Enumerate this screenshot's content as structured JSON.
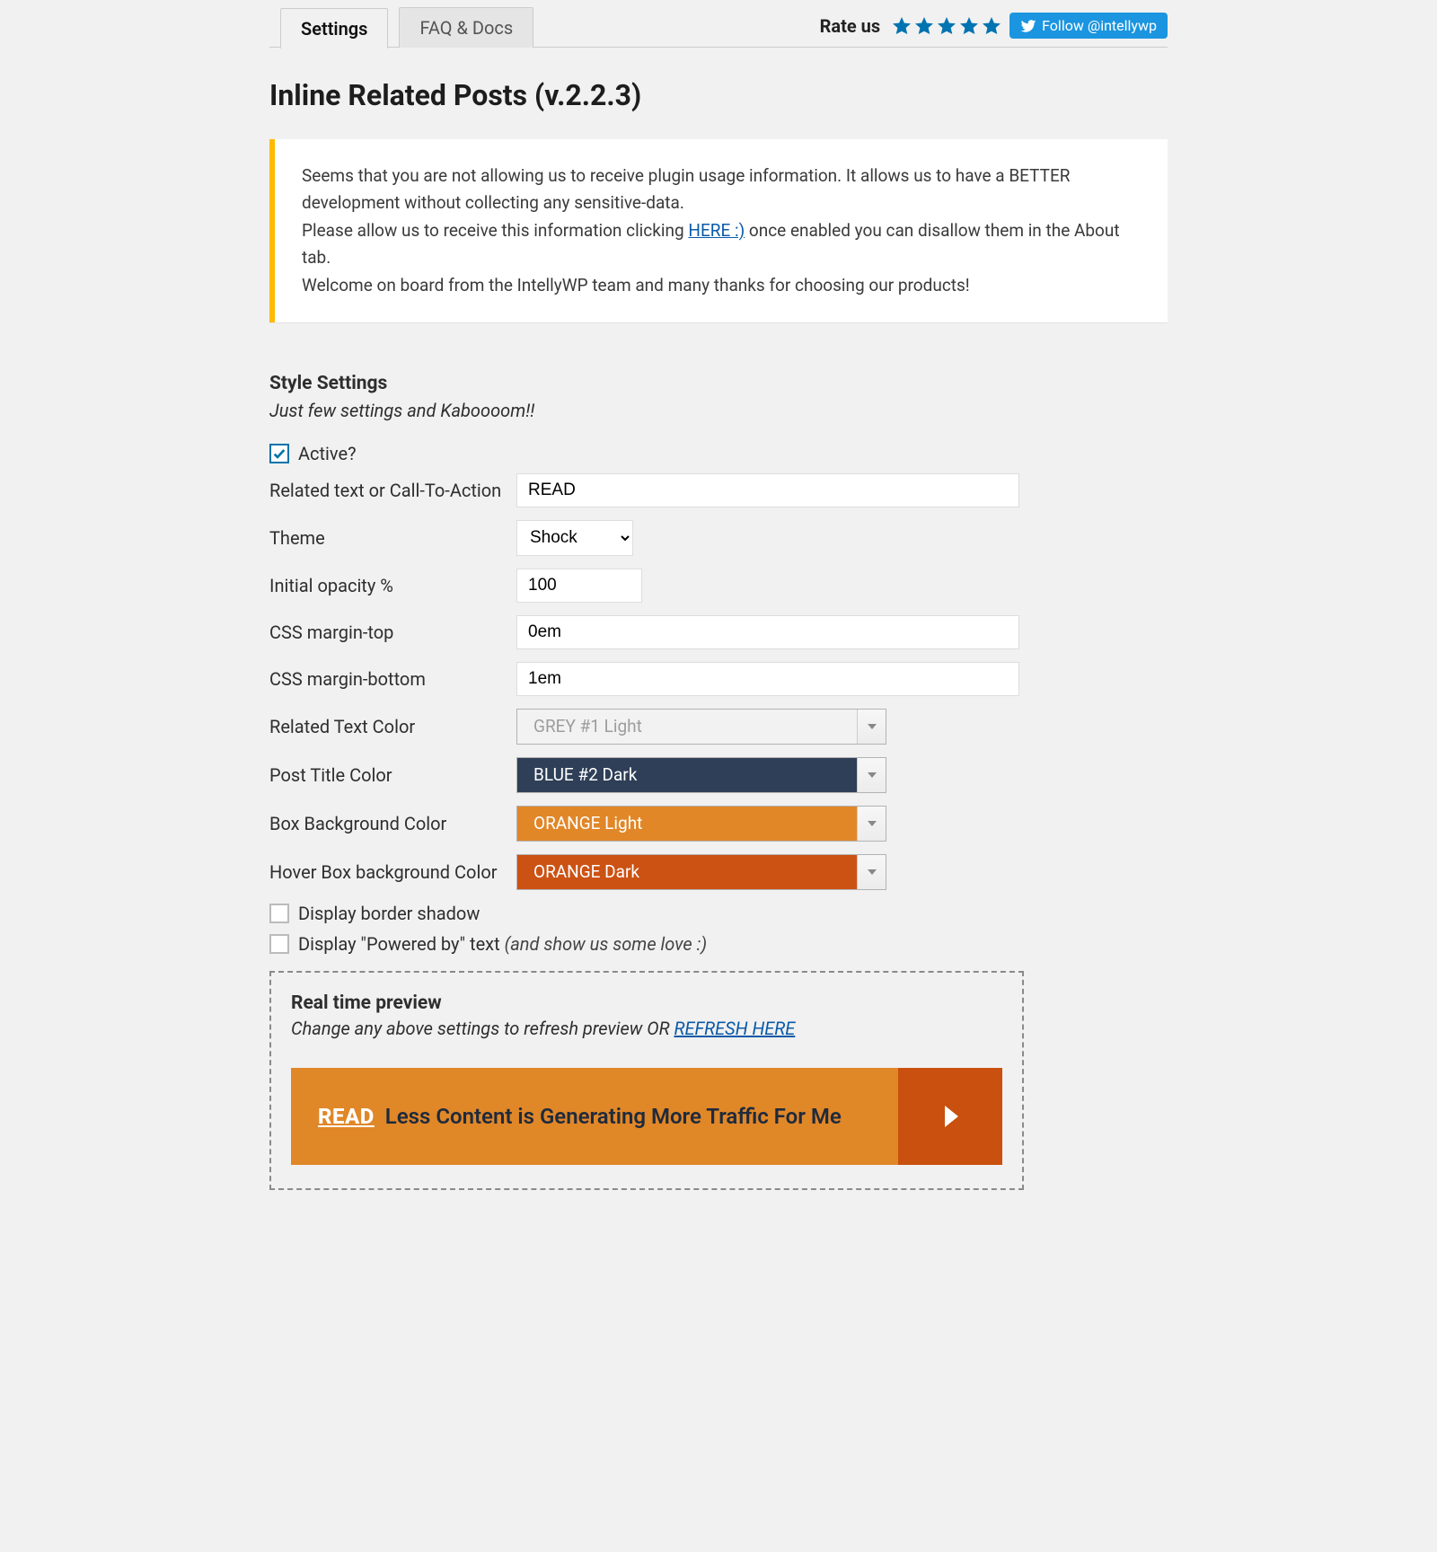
{
  "top": {
    "tabs": [
      "Settings",
      "FAQ & Docs"
    ],
    "active_tab": 0,
    "rate_label": "Rate us",
    "twitter_label": "Follow @intellywp"
  },
  "page_title": "Inline Related Posts (v.2.2.3)",
  "notice": {
    "line1": "Seems that you are not allowing us to receive plugin usage information. It allows us to have a BETTER development without collecting any sensitive-data.",
    "line2a": "Please allow us to receive this information clicking ",
    "line2_link": "HERE :)",
    "line2b": " once enabled you can disallow them in the About tab.",
    "line3": "Welcome on board from the IntellyWP team and many thanks for choosing our products!"
  },
  "style": {
    "section_title": "Style Settings",
    "section_sub": "Just few settings and Kaboooom!!",
    "active_label": "Active?",
    "active_checked": true,
    "labels": {
      "related_text": "Related text or Call-To-Action",
      "theme": "Theme",
      "opacity": "Initial opacity %",
      "margin_top": "CSS margin-top",
      "margin_bottom": "CSS margin-bottom",
      "related_text_color": "Related Text Color",
      "post_title_color": "Post Title Color",
      "box_bg_color": "Box Background Color",
      "hover_box_bg_color": "Hover Box background Color",
      "border_shadow": "Display border shadow",
      "powered_by": "Display \"Powered by\" text ",
      "powered_by_note": "(and show us some love :)"
    },
    "values": {
      "related_text": "READ",
      "theme": "Shock",
      "opacity": "100",
      "margin_top": "0em",
      "margin_bottom": "1em",
      "related_text_color": "GREY #1 Light",
      "post_title_color": "BLUE #2 Dark",
      "box_bg_color": "ORANGE Light",
      "hover_box_bg_color": "ORANGE Dark"
    }
  },
  "preview": {
    "title": "Real time preview",
    "sub_a": "Change any above settings to refresh preview OR ",
    "sub_link": "REFRESH HERE",
    "read_label": "READ",
    "post_title": "Less Content is Generating More Traffic For Me"
  }
}
